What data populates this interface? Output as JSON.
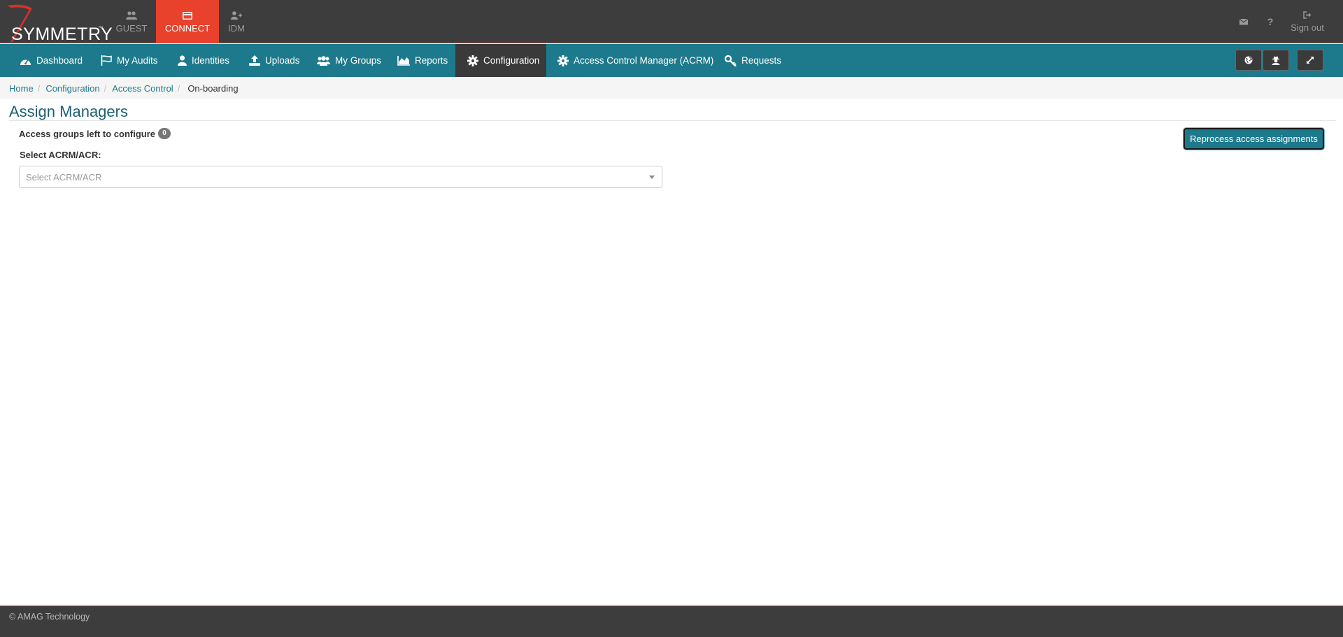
{
  "brand": {
    "name": "SYMMETRY",
    "tm": "™"
  },
  "app_tabs": [
    {
      "label": "GUEST",
      "icon": "users-icon"
    },
    {
      "label": "CONNECT",
      "icon": "card-icon",
      "active": true
    },
    {
      "label": "IDM",
      "icon": "user-plus-icon"
    }
  ],
  "top_right": {
    "mail_icon": "envelope-icon",
    "help_label": "?",
    "signout_label": "Sign out"
  },
  "nav": {
    "items": [
      {
        "label": "Dashboard",
        "icon": "dashboard-icon"
      },
      {
        "label": "My Audits",
        "icon": "flag-icon"
      },
      {
        "label": "Identities",
        "icon": "user-icon"
      },
      {
        "label": "Uploads",
        "icon": "upload-icon"
      },
      {
        "label": "My Groups",
        "icon": "users-icon"
      },
      {
        "label": "Reports",
        "icon": "area-chart-icon"
      },
      {
        "label": "Configuration",
        "icon": "gear-icon",
        "active": true
      },
      {
        "label": "Access Control Manager (ACRM)",
        "icon": "gear-icon"
      },
      {
        "label": "Requests",
        "icon": "key-icon"
      }
    ],
    "right_buttons": [
      "globe-icon",
      "user-secret-icon",
      "expand-icon"
    ]
  },
  "breadcrumb": [
    "Home",
    "Configuration",
    "Access Control",
    "On-boarding"
  ],
  "page": {
    "title": "Assign Managers",
    "groups_left_label": "Access groups left to configure",
    "groups_left_count": "0",
    "reprocess_label": "Reprocess access assignments",
    "select_label": "Select ACRM/ACR:",
    "select_placeholder": "Select ACRM/ACR"
  },
  "footer": {
    "text": "© AMAG Technology"
  },
  "colors": {
    "topbar": "#3d3d3d",
    "accent_red": "#e8412c",
    "nav": "#1d7a8c",
    "nav_active": "#3a3a3a",
    "title": "#1d5f73"
  }
}
